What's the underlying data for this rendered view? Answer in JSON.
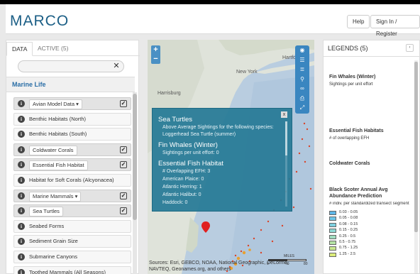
{
  "header": {
    "logo": "MARCO",
    "help_label": "Help",
    "signin_label": "Sign In / Register"
  },
  "leftpanel": {
    "tabs": [
      {
        "label": "DATA",
        "active": true
      },
      {
        "label": "ACTIVE (5)",
        "active": false
      }
    ],
    "search": {
      "placeholder": "",
      "clear_label": "✕"
    },
    "section_title": "Marine Life",
    "layers": [
      {
        "label": "Avian Model Data ▾",
        "dropdown": true,
        "checked": true,
        "selected": true
      },
      {
        "label": "Benthic Habitats (North)",
        "dropdown": false,
        "checked": false,
        "selected": false
      },
      {
        "label": "Benthic Habitats (South)",
        "dropdown": false,
        "checked": false,
        "selected": false
      },
      {
        "label": "Coldwater Corals",
        "dropdown": false,
        "checked": true,
        "selected": true
      },
      {
        "label": "Essential Fish Habitat",
        "dropdown": false,
        "checked": true,
        "selected": true
      },
      {
        "label": "Habitat for Soft Corals (Alcyonacea)",
        "dropdown": false,
        "checked": false,
        "selected": false
      },
      {
        "label": "Marine Mammals ▾",
        "dropdown": true,
        "checked": true,
        "selected": true
      },
      {
        "label": "Sea Turtles",
        "dropdown": false,
        "checked": true,
        "selected": true
      },
      {
        "label": "Seabed Forms",
        "dropdown": false,
        "checked": false,
        "selected": false
      },
      {
        "label": "Sediment Grain Size",
        "dropdown": false,
        "checked": false,
        "selected": false
      },
      {
        "label": "Submarine Canyons",
        "dropdown": false,
        "checked": false,
        "selected": false
      },
      {
        "label": "Toothed Mammals (All Seasons)",
        "dropdown": false,
        "checked": false,
        "selected": false
      }
    ]
  },
  "map": {
    "zoom_in": "+",
    "zoom_out": "−",
    "place_labels": [
      "New York",
      "Hartford",
      "Harrisburg"
    ],
    "popup": {
      "close": "x",
      "sea_turtles_title": "Sea Turtles",
      "sea_turtles_line1": "Above Average Sightings for the following species:",
      "sea_turtles_line2": "Loggerhead Sea Turtle (summer)",
      "fin_whales_title": "Fin Whales (Winter)",
      "fin_whales_line": "Sightings per unit effort: 0",
      "efh_title": "Essential Fish Habitat",
      "efh_lines": [
        "# Overlapping EFH: 3",
        "American Plaice: 0",
        "Atlantic Herring: 1",
        "Atlantic Halibut: 0",
        "Haddock: 0"
      ]
    },
    "scale_label": "MILES",
    "scale_ticks": [
      "0",
      "40",
      "80"
    ],
    "attribution": "Sources: Esri, GEBCO, NOAA, National Geographic, DeLorme, NAVTEQ, Geonames.org, and others"
  },
  "legend": {
    "title": "LEGENDS (5)",
    "collapse": "‹",
    "sections": [
      {
        "title": "Fin Whales (Winter)",
        "subtitle": "Sightings per unit effort"
      },
      {
        "title": "Essential Fish Habitats",
        "subtitle": "# of overlapping EFH"
      },
      {
        "title": "Coldwater Corals",
        "subtitle": ""
      },
      {
        "title": "Black Scoter Annual Avg Abundance Prediction",
        "subtitle": "# indiv. per standardized transect segment"
      }
    ],
    "scoter_classes": [
      {
        "label": "0.03 - 0.05",
        "color": "#5fb6e6"
      },
      {
        "label": "0.05 - 0.08",
        "color": "#6ec6e8"
      },
      {
        "label": "0.08 - 0.15",
        "color": "#7fd0e0"
      },
      {
        "label": "0.15 - 0.25",
        "color": "#8dd8d4"
      },
      {
        "label": "0.25 - 0.5",
        "color": "#a0ddbf"
      },
      {
        "label": "0.5 - 0.75",
        "color": "#b5e3a5"
      },
      {
        "label": "0.75 - 1.25",
        "color": "#c9e88f"
      },
      {
        "label": "1.25 - 2.5",
        "color": "#dcec7a"
      }
    ]
  }
}
